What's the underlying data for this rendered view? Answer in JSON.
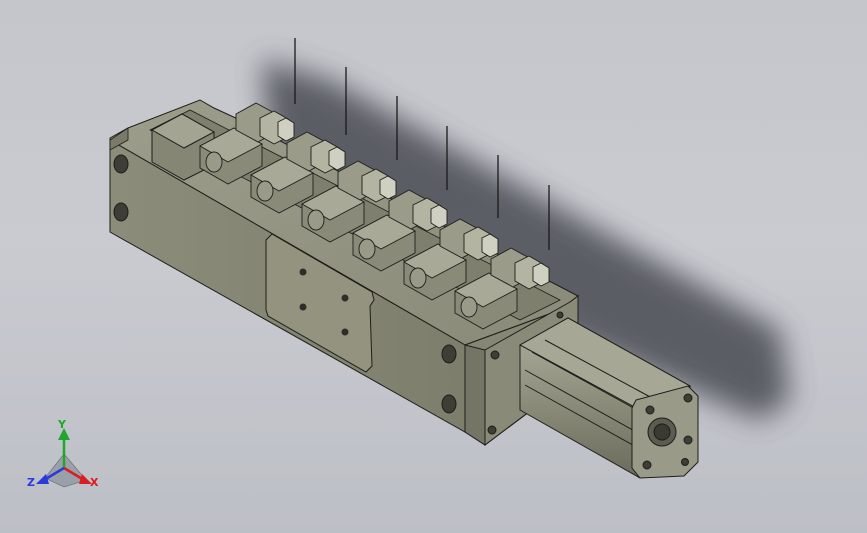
{
  "viewport": {
    "background_top": "#c4c6cc",
    "background_bottom": "#bdbfc6"
  },
  "model": {
    "body_color": "#8e8e7c",
    "body_dark": "#6f6f60",
    "body_light": "#a3a392",
    "edge_color": "#1e1e1a",
    "shadow_color": "#4a4c52",
    "slider_count": 6
  },
  "triad": {
    "x_label": "X",
    "y_label": "Y",
    "z_label": "Z",
    "x_color": "#d81e1e",
    "y_color": "#1ea82a",
    "z_color": "#2a3ad8"
  }
}
